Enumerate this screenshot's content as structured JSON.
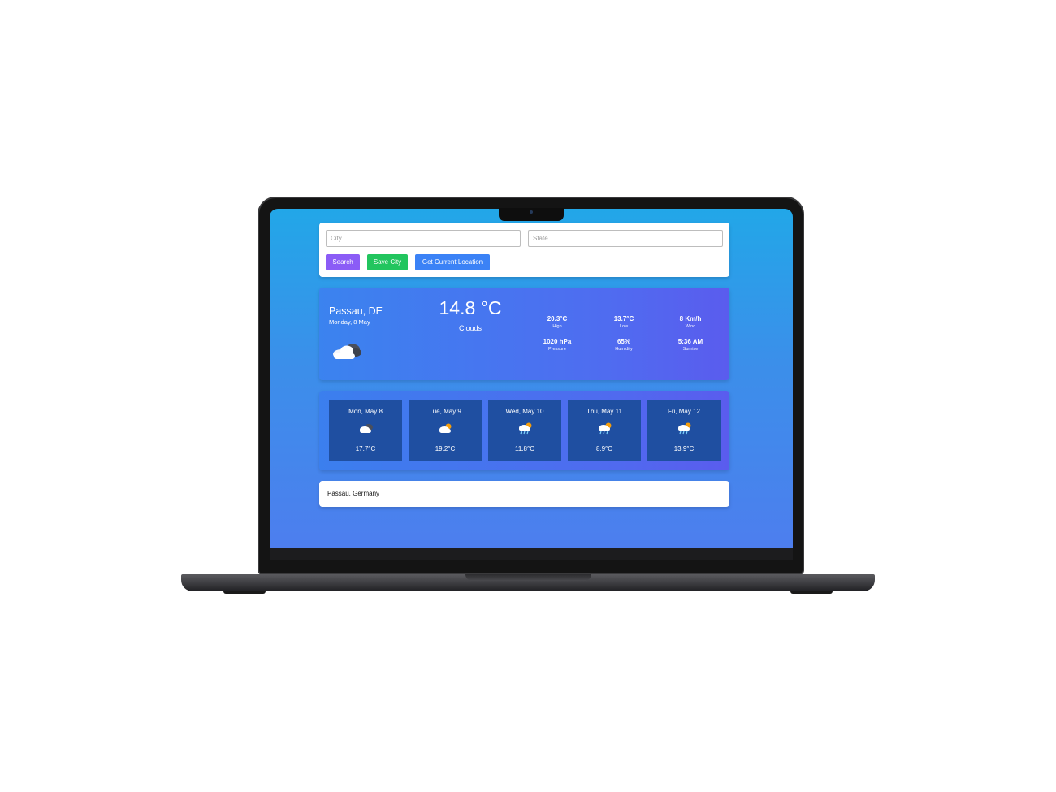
{
  "search": {
    "city_placeholder": "City",
    "state_placeholder": "State",
    "search_label": "Search",
    "save_label": "Save City",
    "location_label": "Get Current Location"
  },
  "current": {
    "location": "Passau, DE",
    "date": "Monday, 8 May",
    "temperature": "14.8 °C",
    "description": "Clouds",
    "icon": "cloudy-icon",
    "stats": [
      {
        "value": "20.3°C",
        "label": "High"
      },
      {
        "value": "13.7°C",
        "label": "Low"
      },
      {
        "value": "8 Km/h",
        "label": "Wind"
      },
      {
        "value": "1020 hPa",
        "label": "Pressure"
      },
      {
        "value": "65%",
        "label": "Humidity"
      },
      {
        "value": "5:36 AM",
        "label": "Sunrise"
      }
    ]
  },
  "forecast": [
    {
      "day": "Mon, May 8",
      "icon": "cloudy-icon",
      "temp": "17.7°C"
    },
    {
      "day": "Tue, May 9",
      "icon": "partly-cloudy-icon",
      "temp": "19.2°C"
    },
    {
      "day": "Wed, May 10",
      "icon": "rain-sun-icon",
      "temp": "11.8°C"
    },
    {
      "day": "Thu, May 11",
      "icon": "rain-sun-icon",
      "temp": "8.9°C"
    },
    {
      "day": "Fri, May 12",
      "icon": "rain-sun-icon",
      "temp": "13.9°C"
    }
  ],
  "saved_cities": [
    "Passau, Germany"
  ],
  "colors": {
    "search_button": "#8b5cf6",
    "save_button": "#22c55e",
    "location_button": "#3b82f6",
    "forecast_tile": "#1f4fa1"
  }
}
